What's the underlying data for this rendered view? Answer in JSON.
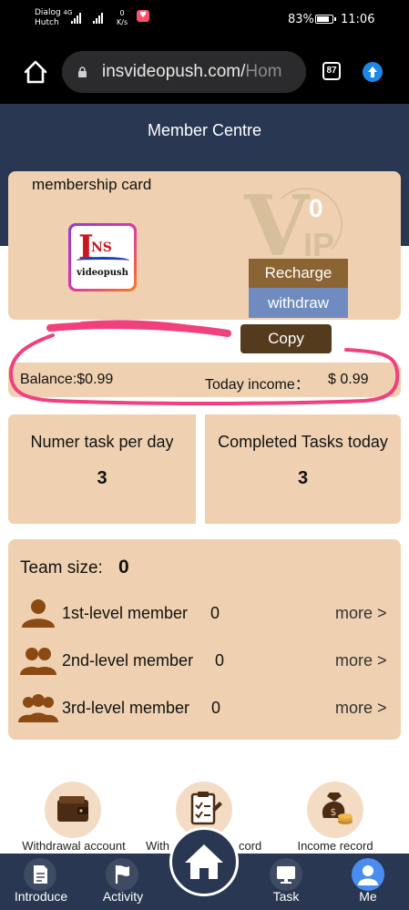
{
  "status_bar": {
    "carrier_line1": "Dialog",
    "carrier_net": "4G",
    "carrier_line2": "Hutch",
    "speed_value": "0",
    "speed_unit": "K/s",
    "battery": "83%",
    "time": "11:06"
  },
  "browser": {
    "url_main": "insvideopush.com/",
    "url_fade": "Hom",
    "tab_count": "87"
  },
  "header": {
    "title": "Member Centre"
  },
  "membership_card": {
    "title": "membership card",
    "logo_text_i": "I",
    "logo_text_ns": "NS",
    "logo_subtext": "videopush",
    "vip_v": "V",
    "vip_ip": "IP",
    "vip_level": "0",
    "recharge_label": "Recharge",
    "withdraw_label": "withdraw",
    "copy_label": "Copy"
  },
  "balance": {
    "balance_text": "Balance:$0.99",
    "income_label": "Today income：",
    "income_value": "$ 0.99"
  },
  "tasks": {
    "per_day_label": "Numer task per day",
    "per_day_value": "3",
    "completed_label": "Completed Tasks today",
    "completed_value": "3"
  },
  "team": {
    "title": "Team size:",
    "count": "0",
    "levels": [
      {
        "label": "1st-level member",
        "count": "0",
        "more": "more >"
      },
      {
        "label": "2nd-level member",
        "count": "0",
        "more": "more >"
      },
      {
        "label": "3rd-level member",
        "count": "0",
        "more": "more >"
      }
    ]
  },
  "shortcuts": [
    {
      "label": "Withdrawal account",
      "icon": "wallet-icon"
    },
    {
      "label": "With",
      "label_tail": "cord",
      "icon": "clipboard-icon"
    },
    {
      "label": "Income record",
      "icon": "money-bag-icon"
    }
  ],
  "nav": [
    {
      "label": "Introduce",
      "icon": "document-icon"
    },
    {
      "label": "Activity",
      "icon": "flag-icon"
    },
    {
      "label": "",
      "icon": "home-icon"
    },
    {
      "label": "Task",
      "icon": "monitor-icon"
    },
    {
      "label": "Me",
      "icon": "user-icon"
    }
  ],
  "colors": {
    "header_bg": "#2a3752",
    "card_bg": "#efd1b1",
    "recharge_bg": "#8a6533",
    "withdraw_bg": "#6f8bc0",
    "copy_bg": "#553b1d",
    "highlight_stroke": "#f0407e",
    "me_accent": "#4a8df0"
  }
}
